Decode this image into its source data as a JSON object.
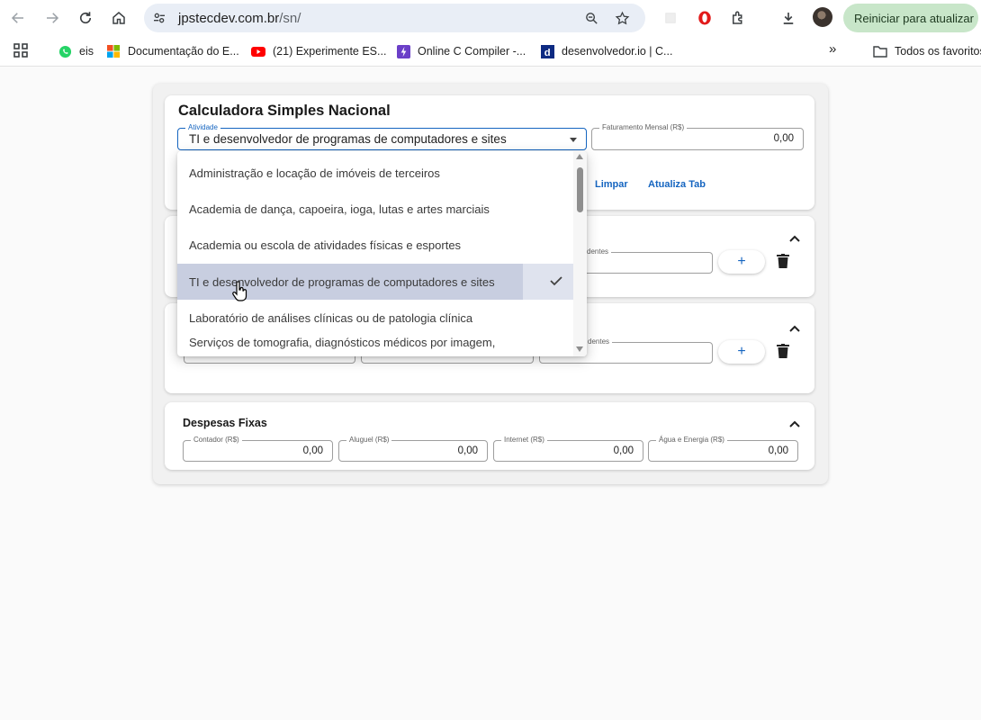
{
  "browser": {
    "url_host": "jpstecdev.com.br",
    "url_path": "/sn/",
    "restart_label": "Reiniciar para atualizar",
    "bookmarks": [
      {
        "label": "eis",
        "icon": "whatsapp-icon"
      },
      {
        "label": "Documentação do E...",
        "icon": "microsoft-icon"
      },
      {
        "label": "(21) Experimente ES...",
        "icon": "youtube-icon"
      },
      {
        "label": "Online C Compiler -...",
        "icon": "bolt-icon"
      },
      {
        "label": "desenvolvedor.io | C...",
        "icon": "d-logo-icon"
      }
    ],
    "more_label": "»",
    "all_bookmarks_label": "Todos os favoritos"
  },
  "app": {
    "title": "Calculadora Simples Nacional",
    "atividade": {
      "label": "Atividade",
      "value": "TI e desenvolvedor de programas de computadores e sites"
    },
    "faturamento": {
      "label": "Faturamento Mensal (R$)",
      "value": "0,00"
    },
    "buttons": {
      "limpar": "Limpar",
      "atualiza": "Atualiza Tab"
    },
    "partial_label_1": "dentes",
    "partial_label_2": "dentes",
    "plus_label": "+",
    "despesas": {
      "title": "Despesas Fixas",
      "fields": [
        {
          "label": "Contador (R$)",
          "value": "0,00"
        },
        {
          "label": "Aluguel (R$)",
          "value": "0,00"
        },
        {
          "label": "Internet (R$)",
          "value": "0,00"
        },
        {
          "label": "Água e Energia (R$)",
          "value": "0,00"
        }
      ]
    }
  },
  "menu": {
    "options": [
      "Administração e locação de imóveis de terceiros",
      "Academia de dança, capoeira, ioga, lutas e artes marciais",
      "Academia ou escola de atividades físicas e esportes",
      "TI e desenvolvedor de programas de computadores e sites",
      "Laboratório de análises clínicas ou de patologia clínica",
      "Serviços de tomografia, diagnósticos médicos por imagem,"
    ],
    "selected_index": 3
  },
  "colors": {
    "accent": "#1565c0",
    "restart_bg": "#c8e6c9"
  }
}
